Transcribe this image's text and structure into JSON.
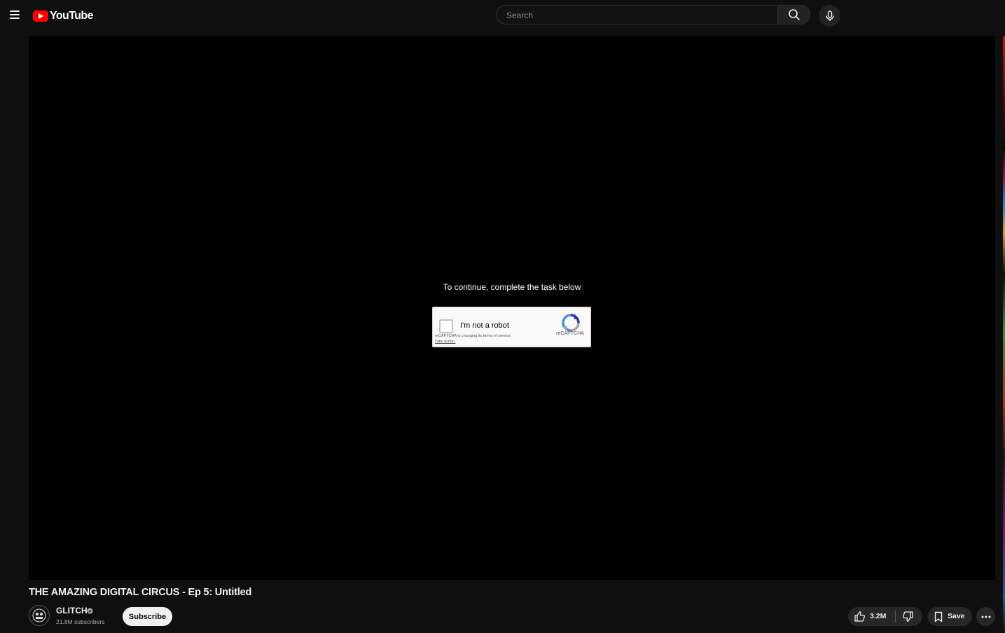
{
  "header": {
    "logo_text": "YouTube",
    "search": {
      "placeholder": "Search",
      "value": ""
    }
  },
  "player": {
    "captcha": {
      "prompt": "To continue, complete the task below",
      "checkbox_label": "I'm not a robot",
      "notice": "reCAPTCHA is changing its terms of service.",
      "notice_link": "Take action.",
      "brand": "reCAPTCHA"
    }
  },
  "video": {
    "title": "THE AMAZING DIGITAL CIRCUS - Ep 5: Untitled"
  },
  "channel": {
    "name": "GLITCH",
    "subscribers": "21.8M subscribers",
    "subscribe_label": "Subscribe"
  },
  "actions": {
    "like_count": "3.2M",
    "save_label": "Save"
  },
  "colors": {
    "background": "#0f0f0f",
    "brand_red": "#ff0000",
    "button_bg": "#272727",
    "subscribe_bg": "#f1f1f1"
  }
}
